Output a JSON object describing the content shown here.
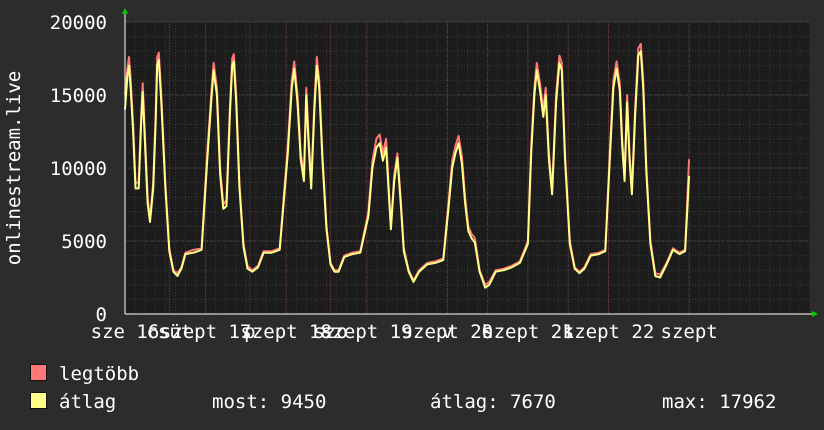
{
  "chart_data": {
    "type": "line",
    "ylabel": "onlinestream.live",
    "ylim": [
      0,
      20000
    ],
    "yticks": [
      0,
      5000,
      10000,
      15000,
      20000
    ],
    "ytick_labels": [
      "0",
      "5000",
      "10000",
      "15000",
      "20000"
    ],
    "xlim": [
      0,
      8.5
    ],
    "xticks": [
      {
        "x": 0,
        "label": "sze 16"
      },
      {
        "x": 1,
        "label": "szept 17"
      },
      {
        "x": 2,
        "label": "szept 18"
      },
      {
        "x": 3,
        "label": "szept 19"
      },
      {
        "x": 4,
        "label": "szept 20"
      },
      {
        "x": 5,
        "label": "szept 21"
      },
      {
        "x": 6,
        "label": "szept 22"
      },
      {
        "x": 7,
        "label": "szept"
      }
    ],
    "xtick_overlaps": [
      {
        "x": 0.55,
        "label": "csüt"
      },
      {
        "x": 1.55,
        "label": "p"
      },
      {
        "x": 2.55,
        "label": "szo"
      },
      {
        "x": 4.0,
        "label": "v"
      },
      {
        "x": 4.5,
        "label": "h"
      },
      {
        "x": 5.5,
        "label": "k"
      }
    ],
    "grid": true,
    "series": [
      {
        "name": "legtöbb",
        "color": "#ff7777",
        "points": [
          [
            0.0,
            15000
          ],
          [
            0.03,
            16800
          ],
          [
            0.05,
            17600
          ],
          [
            0.07,
            16200
          ],
          [
            0.1,
            13000
          ],
          [
            0.13,
            9000
          ],
          [
            0.17,
            9000
          ],
          [
            0.2,
            13500
          ],
          [
            0.22,
            15800
          ],
          [
            0.25,
            12000
          ],
          [
            0.28,
            8000
          ],
          [
            0.31,
            6500
          ],
          [
            0.35,
            9000
          ],
          [
            0.38,
            13500
          ],
          [
            0.4,
            17600
          ],
          [
            0.42,
            17900
          ],
          [
            0.45,
            15000
          ],
          [
            0.5,
            9000
          ],
          [
            0.55,
            4500
          ],
          [
            0.6,
            3000
          ],
          [
            0.65,
            2800
          ],
          [
            0.7,
            3200
          ],
          [
            0.75,
            4200
          ],
          [
            0.85,
            4400
          ],
          [
            0.95,
            4500
          ],
          [
            1.02,
            11000
          ],
          [
            1.07,
            15000
          ],
          [
            1.1,
            17200
          ],
          [
            1.14,
            15500
          ],
          [
            1.18,
            10000
          ],
          [
            1.22,
            7500
          ],
          [
            1.26,
            7800
          ],
          [
            1.3,
            14000
          ],
          [
            1.33,
            17500
          ],
          [
            1.35,
            17800
          ],
          [
            1.38,
            15000
          ],
          [
            1.42,
            9000
          ],
          [
            1.47,
            4800
          ],
          [
            1.52,
            3300
          ],
          [
            1.58,
            3000
          ],
          [
            1.65,
            3300
          ],
          [
            1.72,
            4300
          ],
          [
            1.82,
            4300
          ],
          [
            1.92,
            4500
          ],
          [
            2.02,
            11500
          ],
          [
            2.07,
            16000
          ],
          [
            2.1,
            17300
          ],
          [
            2.14,
            15000
          ],
          [
            2.18,
            11000
          ],
          [
            2.22,
            9500
          ],
          [
            2.25,
            15500
          ],
          [
            2.28,
            12000
          ],
          [
            2.31,
            9000
          ],
          [
            2.35,
            14500
          ],
          [
            2.38,
            17600
          ],
          [
            2.41,
            16000
          ],
          [
            2.45,
            11000
          ],
          [
            2.5,
            6000
          ],
          [
            2.55,
            3500
          ],
          [
            2.6,
            3000
          ],
          [
            2.65,
            3000
          ],
          [
            2.72,
            4000
          ],
          [
            2.82,
            4200
          ],
          [
            2.92,
            4300
          ],
          [
            3.02,
            7000
          ],
          [
            3.07,
            10500
          ],
          [
            3.12,
            12000
          ],
          [
            3.16,
            12300
          ],
          [
            3.2,
            11000
          ],
          [
            3.24,
            12000
          ],
          [
            3.27,
            9000
          ],
          [
            3.3,
            6000
          ],
          [
            3.34,
            9500
          ],
          [
            3.38,
            11000
          ],
          [
            3.42,
            8000
          ],
          [
            3.46,
            4500
          ],
          [
            3.52,
            3000
          ],
          [
            3.58,
            2300
          ],
          [
            3.65,
            3000
          ],
          [
            3.75,
            3500
          ],
          [
            3.85,
            3600
          ],
          [
            3.95,
            3800
          ],
          [
            4.02,
            8000
          ],
          [
            4.06,
            10500
          ],
          [
            4.1,
            11500
          ],
          [
            4.14,
            12200
          ],
          [
            4.18,
            10800
          ],
          [
            4.22,
            8000
          ],
          [
            4.26,
            6000
          ],
          [
            4.3,
            5500
          ],
          [
            4.34,
            5200
          ],
          [
            4.4,
            3000
          ],
          [
            4.47,
            2000
          ],
          [
            4.52,
            2200
          ],
          [
            4.6,
            3000
          ],
          [
            4.7,
            3100
          ],
          [
            4.8,
            3300
          ],
          [
            4.9,
            3600
          ],
          [
            5.0,
            5000
          ],
          [
            5.04,
            11500
          ],
          [
            5.08,
            15500
          ],
          [
            5.11,
            17200
          ],
          [
            5.15,
            15800
          ],
          [
            5.19,
            14000
          ],
          [
            5.22,
            15500
          ],
          [
            5.26,
            11000
          ],
          [
            5.3,
            8500
          ],
          [
            5.35,
            15000
          ],
          [
            5.39,
            17700
          ],
          [
            5.42,
            17200
          ],
          [
            5.46,
            11000
          ],
          [
            5.52,
            5000
          ],
          [
            5.58,
            3200
          ],
          [
            5.64,
            2900
          ],
          [
            5.7,
            3200
          ],
          [
            5.78,
            4100
          ],
          [
            5.88,
            4200
          ],
          [
            5.96,
            4400
          ],
          [
            6.02,
            11500
          ],
          [
            6.06,
            16000
          ],
          [
            6.1,
            17300
          ],
          [
            6.14,
            15800
          ],
          [
            6.17,
            12000
          ],
          [
            6.2,
            9500
          ],
          [
            6.23,
            15000
          ],
          [
            6.26,
            11000
          ],
          [
            6.29,
            8500
          ],
          [
            6.33,
            14000
          ],
          [
            6.37,
            18200
          ],
          [
            6.4,
            18500
          ],
          [
            6.43,
            16000
          ],
          [
            6.47,
            10000
          ],
          [
            6.52,
            5000
          ],
          [
            6.58,
            2800
          ],
          [
            6.64,
            2700
          ],
          [
            6.72,
            3500
          ],
          [
            6.8,
            4500
          ],
          [
            6.88,
            4200
          ],
          [
            6.95,
            4400
          ],
          [
            7.0,
            10600
          ]
        ]
      },
      {
        "name": "átlag",
        "color": "#ffff88",
        "points": [
          [
            0.0,
            14000
          ],
          [
            0.03,
            16300
          ],
          [
            0.05,
            17000
          ],
          [
            0.07,
            15500
          ],
          [
            0.1,
            12500
          ],
          [
            0.13,
            8600
          ],
          [
            0.17,
            8600
          ],
          [
            0.2,
            13000
          ],
          [
            0.22,
            15200
          ],
          [
            0.25,
            11500
          ],
          [
            0.28,
            7600
          ],
          [
            0.31,
            6300
          ],
          [
            0.35,
            8600
          ],
          [
            0.38,
            13000
          ],
          [
            0.4,
            17000
          ],
          [
            0.42,
            17400
          ],
          [
            0.45,
            14500
          ],
          [
            0.5,
            8700
          ],
          [
            0.55,
            4300
          ],
          [
            0.6,
            2900
          ],
          [
            0.65,
            2600
          ],
          [
            0.7,
            3100
          ],
          [
            0.75,
            4100
          ],
          [
            0.85,
            4200
          ],
          [
            0.95,
            4400
          ],
          [
            1.02,
            10500
          ],
          [
            1.07,
            14500
          ],
          [
            1.1,
            16700
          ],
          [
            1.14,
            15000
          ],
          [
            1.18,
            9600
          ],
          [
            1.22,
            7200
          ],
          [
            1.26,
            7400
          ],
          [
            1.3,
            13500
          ],
          [
            1.33,
            17000
          ],
          [
            1.35,
            17300
          ],
          [
            1.38,
            14500
          ],
          [
            1.42,
            8700
          ],
          [
            1.47,
            4600
          ],
          [
            1.52,
            3100
          ],
          [
            1.58,
            2900
          ],
          [
            1.65,
            3200
          ],
          [
            1.72,
            4200
          ],
          [
            1.82,
            4200
          ],
          [
            1.92,
            4400
          ],
          [
            2.02,
            11000
          ],
          [
            2.07,
            15500
          ],
          [
            2.1,
            16800
          ],
          [
            2.14,
            14500
          ],
          [
            2.18,
            10600
          ],
          [
            2.22,
            9100
          ],
          [
            2.25,
            15000
          ],
          [
            2.28,
            11500
          ],
          [
            2.31,
            8600
          ],
          [
            2.35,
            14000
          ],
          [
            2.38,
            17000
          ],
          [
            2.41,
            15500
          ],
          [
            2.45,
            10600
          ],
          [
            2.5,
            5800
          ],
          [
            2.55,
            3400
          ],
          [
            2.6,
            2900
          ],
          [
            2.65,
            2900
          ],
          [
            2.72,
            3900
          ],
          [
            2.82,
            4100
          ],
          [
            2.92,
            4200
          ],
          [
            3.02,
            6700
          ],
          [
            3.07,
            10000
          ],
          [
            3.12,
            11400
          ],
          [
            3.16,
            11700
          ],
          [
            3.2,
            10500
          ],
          [
            3.24,
            11400
          ],
          [
            3.27,
            8600
          ],
          [
            3.3,
            5800
          ],
          [
            3.34,
            9100
          ],
          [
            3.38,
            10700
          ],
          [
            3.42,
            7700
          ],
          [
            3.46,
            4300
          ],
          [
            3.52,
            2900
          ],
          [
            3.58,
            2200
          ],
          [
            3.65,
            2900
          ],
          [
            3.75,
            3400
          ],
          [
            3.85,
            3500
          ],
          [
            3.95,
            3700
          ],
          [
            4.02,
            7600
          ],
          [
            4.06,
            10000
          ],
          [
            4.1,
            11000
          ],
          [
            4.14,
            11700
          ],
          [
            4.18,
            10300
          ],
          [
            4.22,
            7600
          ],
          [
            4.26,
            5700
          ],
          [
            4.3,
            5200
          ],
          [
            4.34,
            4900
          ],
          [
            4.4,
            2900
          ],
          [
            4.47,
            1800
          ],
          [
            4.52,
            2000
          ],
          [
            4.6,
            2900
          ],
          [
            4.7,
            3000
          ],
          [
            4.8,
            3200
          ],
          [
            4.9,
            3500
          ],
          [
            5.0,
            4800
          ],
          [
            5.04,
            11000
          ],
          [
            5.08,
            15000
          ],
          [
            5.11,
            16700
          ],
          [
            5.15,
            15300
          ],
          [
            5.19,
            13500
          ],
          [
            5.22,
            15000
          ],
          [
            5.26,
            10600
          ],
          [
            5.3,
            8200
          ],
          [
            5.35,
            14500
          ],
          [
            5.39,
            17200
          ],
          [
            5.42,
            16700
          ],
          [
            5.46,
            10600
          ],
          [
            5.52,
            4800
          ],
          [
            5.58,
            3100
          ],
          [
            5.64,
            2800
          ],
          [
            5.7,
            3100
          ],
          [
            5.78,
            4000
          ],
          [
            5.88,
            4100
          ],
          [
            5.96,
            4300
          ],
          [
            6.02,
            11000
          ],
          [
            6.06,
            15500
          ],
          [
            6.1,
            16800
          ],
          [
            6.14,
            15300
          ],
          [
            6.17,
            11500
          ],
          [
            6.2,
            9100
          ],
          [
            6.23,
            14500
          ],
          [
            6.26,
            10600
          ],
          [
            6.29,
            8200
          ],
          [
            6.33,
            13500
          ],
          [
            6.37,
            17700
          ],
          [
            6.4,
            18000
          ],
          [
            6.43,
            15500
          ],
          [
            6.47,
            9600
          ],
          [
            6.52,
            4800
          ],
          [
            6.58,
            2600
          ],
          [
            6.64,
            2500
          ],
          [
            6.72,
            3400
          ],
          [
            6.8,
            4400
          ],
          [
            6.88,
            4100
          ],
          [
            6.95,
            4300
          ],
          [
            7.0,
            9450
          ]
        ]
      }
    ]
  },
  "legend": {
    "items": [
      {
        "label": "legtöbb",
        "color": "#ff7777"
      },
      {
        "label": "átlag",
        "color": "#ffff88"
      }
    ]
  },
  "stats": {
    "most": "most: 9450",
    "atlag": "átlag: 7670",
    "max": "max: 17962"
  }
}
